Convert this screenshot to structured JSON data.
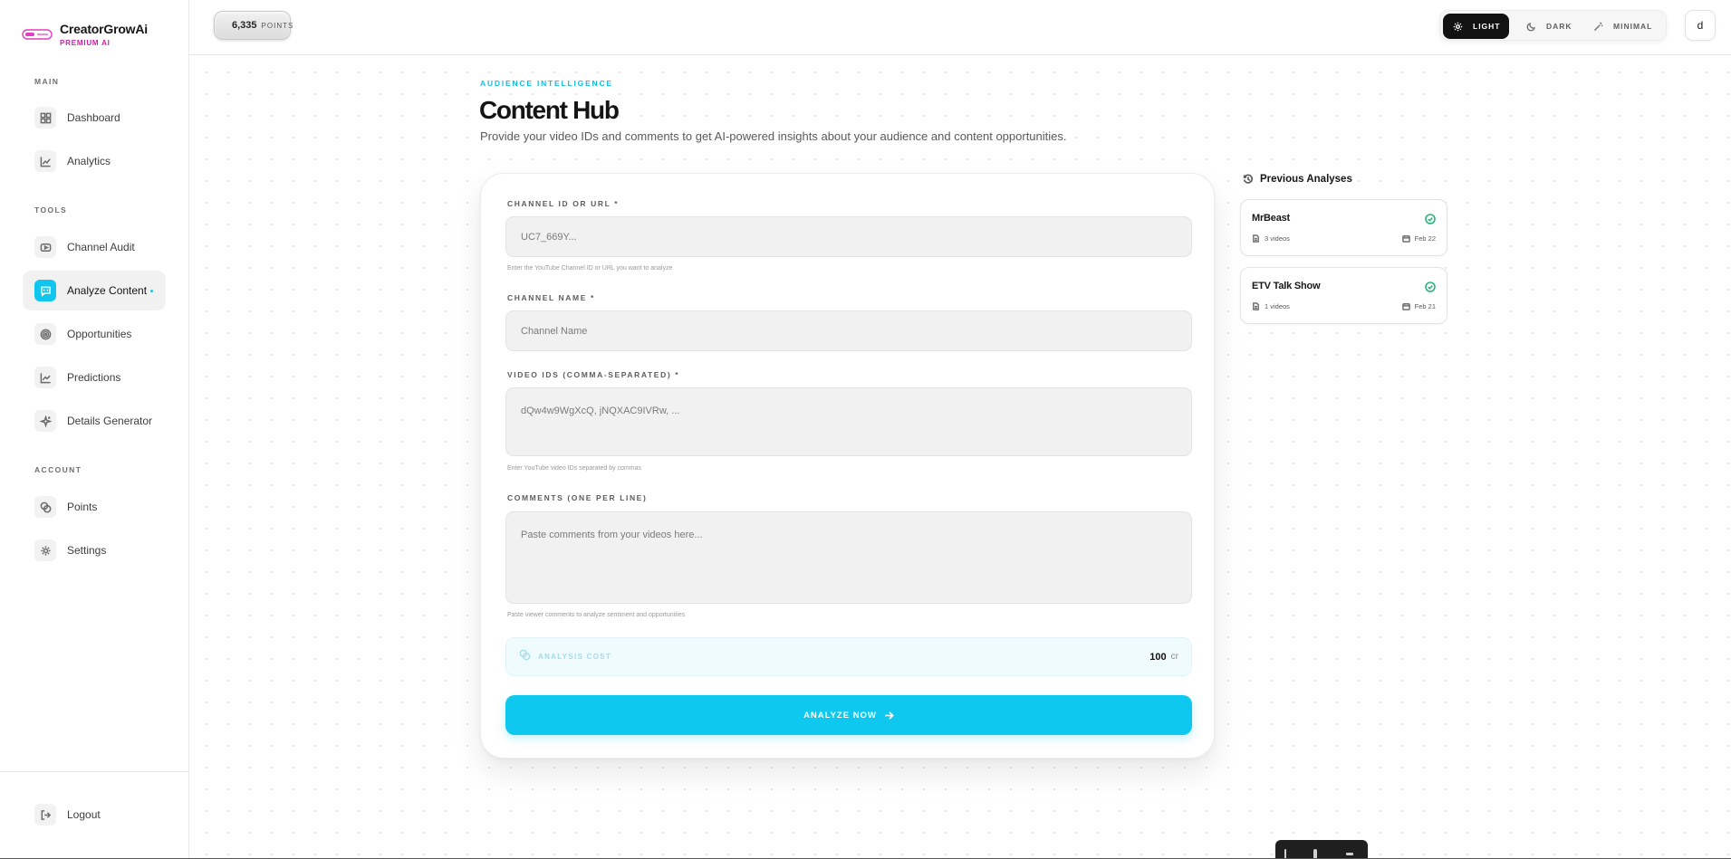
{
  "brand": {
    "title": "CreatorGrowAi",
    "subtitle": "PREMIUM AI"
  },
  "sidebar": {
    "sections": {
      "main": "MAIN",
      "tools": "TOOLS",
      "account": "ACCOUNT"
    },
    "items": {
      "dashboard": "Dashboard",
      "analytics": "Analytics",
      "channel_audit": "Channel Audit",
      "analyze_content": "Analyze Content",
      "opportunities": "Opportunities",
      "predictions": "Predictions",
      "details_generator": "Details Generator",
      "points": "Points",
      "settings": "Settings",
      "logout": "Logout"
    },
    "active_item": "Analyze Content"
  },
  "topbar": {
    "points_value": "6,335",
    "points_label": "POINTS",
    "theme_options": [
      "LIGHT",
      "DARK",
      "MINIMAL"
    ],
    "theme_selected": "LIGHT",
    "avatar_initial": "d"
  },
  "page": {
    "eyebrow": "AUDIENCE INTELLIGENCE",
    "title": "Content Hub",
    "description": "Provide your video IDs and comments to get AI-powered insights about your audience and content opportunities."
  },
  "form": {
    "channel_id_label": "CHANNEL ID OR URL *",
    "channel_id_placeholder": "UC7_669Y...",
    "channel_id_hint": "Enter the YouTube Channel ID or URL you want to analyze",
    "channel_name_label": "CHANNEL NAME *",
    "channel_name_placeholder": "Channel Name",
    "video_ids_label": "VIDEO IDS (COMMA-SEPARATED) *",
    "video_ids_placeholder": "dQw4w9WgXcQ, jNQXAC9IVRw, ...",
    "video_ids_hint": "Enter YouTube video IDs separated by commas",
    "comments_label": "COMMENTS (ONE PER LINE)",
    "comments_placeholder": "Paste comments from your videos here...",
    "comments_hint": "Paste viewer comments to analyze sentiment and opportunities",
    "cost_label": "ANALYSIS COST",
    "cost_value": "100",
    "cost_unit": "cr",
    "submit_label": "ANALYZE NOW"
  },
  "previous": {
    "title": "Previous Analyses",
    "items": [
      {
        "name": "MrBeast",
        "videos": "3 videos",
        "date": "Feb 22"
      },
      {
        "name": "ETV Talk Show",
        "videos": "1 videos",
        "date": "Feb 21"
      }
    ]
  },
  "colors": {
    "accent": "#0ec8ef",
    "brand_pink": "#d21aa6",
    "success": "#28b57a",
    "dark": "#121212"
  }
}
